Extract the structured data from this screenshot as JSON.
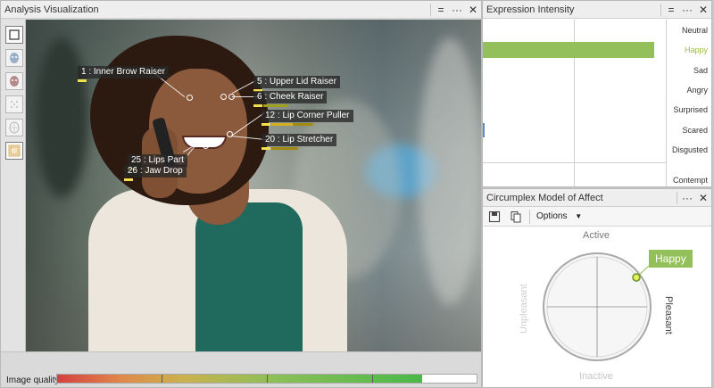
{
  "analysis": {
    "title": "Analysis Visualization",
    "image_quality_label": "Image quality",
    "image_quality_fraction": 0.87,
    "action_units": [
      {
        "label": "1 : Inner Brow Raiser",
        "bars": [
          "#f4e04d"
        ]
      },
      {
        "label": "5 : Upper Lid Raiser",
        "bars": [
          "#f4e04d"
        ]
      },
      {
        "label": "6 : Cheek Raiser",
        "bars": [
          "#f4e04d",
          "#a0a020"
        ]
      },
      {
        "label": "12 : Lip Corner Puller",
        "bars": [
          "#f4e04d",
          "#d4b020",
          "#a08a10"
        ]
      },
      {
        "label": "20 : Lip Stretcher",
        "bars": [
          "#f4e04d",
          "#a08a10"
        ]
      },
      {
        "label": "25 : Lips Part",
        "bars": [
          "#f4e04d"
        ]
      },
      {
        "label": "26 : Jaw Drop",
        "bars": [
          "#f4e04d"
        ]
      }
    ]
  },
  "expression": {
    "title": "Expression Intensity",
    "emotions": [
      {
        "name": "Neutral",
        "value": 0.0
      },
      {
        "name": "Happy",
        "value": 0.96
      },
      {
        "name": "Sad",
        "value": 0.0
      },
      {
        "name": "Angry",
        "value": 0.0
      },
      {
        "name": "Surprised",
        "value": 0.0
      },
      {
        "name": "Scared",
        "value": 0.0
      },
      {
        "name": "Disgusted",
        "value": 0.0
      },
      {
        "name": "Contempt",
        "value": 0.0
      }
    ],
    "highlight": "Happy",
    "highlight_color": "#9bbf35",
    "bar_color": "#93c05a"
  },
  "circumplex": {
    "title": "Circumplex Model of Affect",
    "options_label": "Options",
    "active_label": "Active",
    "inactive_label": "Inactive",
    "pleasant_label": "Pleasant",
    "unpleasant_label": "Unpleasant",
    "current_emotion": "Happy"
  },
  "icons": {
    "pin": "=",
    "more": "···",
    "close": "✕"
  }
}
